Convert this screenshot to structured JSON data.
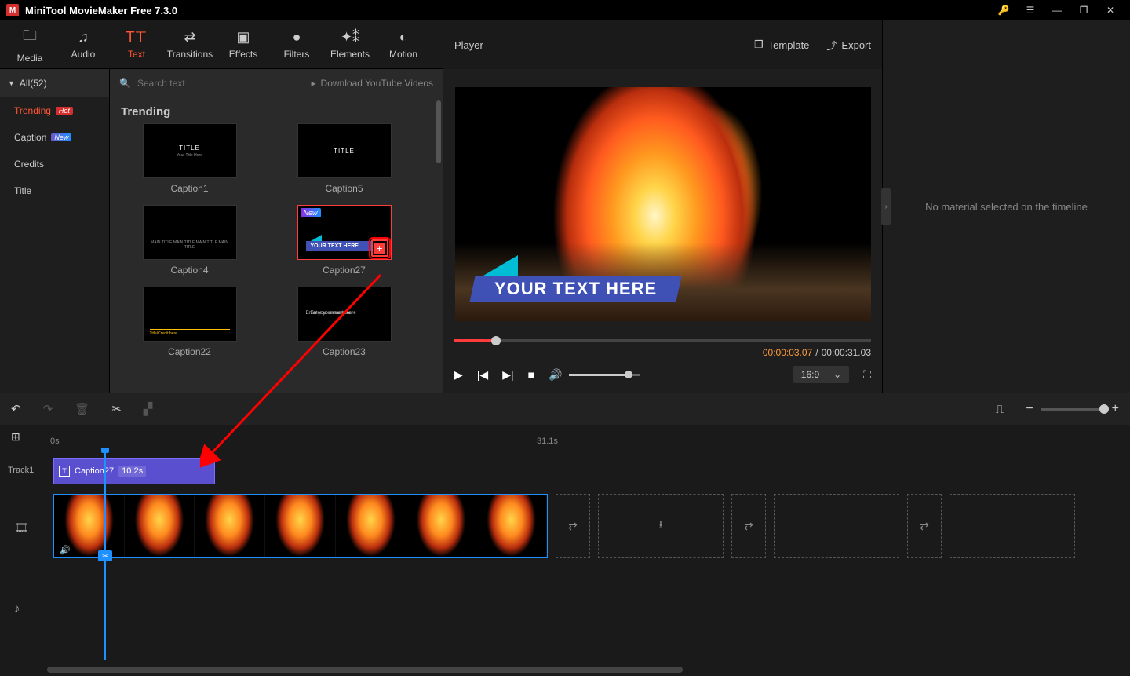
{
  "app": {
    "title": "MiniTool MovieMaker Free 7.3.0"
  },
  "toolbar": {
    "media": "Media",
    "audio": "Audio",
    "text": "Text",
    "transitions": "Transitions",
    "effects": "Effects",
    "filters": "Filters",
    "elements": "Elements",
    "motion": "Motion"
  },
  "categories": {
    "all": "All(52)",
    "items": [
      {
        "label": "Trending",
        "badge": "Hot",
        "active": true
      },
      {
        "label": "Caption",
        "badge": "New"
      },
      {
        "label": "Credits"
      },
      {
        "label": "Title"
      }
    ]
  },
  "search": {
    "placeholder": "Search text"
  },
  "download_yt": "Download YouTube Videos",
  "section": {
    "title": "Trending"
  },
  "thumbs": {
    "cap1_pv_title": "TITLE",
    "cap1_pv_sub": "Your Title Here",
    "cap5_pv": "TITLE",
    "cap4_pv": "MAIN TITLE MAIN TITLE MAIN TITLE MAIN TITLE",
    "cap27_pv": "YOUR TEXT HERE",
    "cap22_pv": "Title/Credit here",
    "cap23_pv": "Enter your name here",
    "l": [
      {
        "label": "Caption1"
      },
      {
        "label": "Caption5"
      },
      {
        "label": "Caption4"
      },
      {
        "label": "Caption27",
        "selected": true,
        "new": true,
        "add": true
      },
      {
        "label": "Caption22"
      },
      {
        "label": "Caption23"
      }
    ]
  },
  "player": {
    "title": "Player",
    "template": "Template",
    "export": "Export",
    "overlay_text": "YOUR TEXT HERE",
    "time_current": "00:00:03.07",
    "time_sep": "/",
    "time_total": "00:00:31.03",
    "ratio": "16:9"
  },
  "inspector": {
    "empty": "No material selected on the timeline"
  },
  "timeline": {
    "ruler_start": "0s",
    "ruler_mid": "31.1s",
    "track1_label": "Track1",
    "clip_name": "Caption27",
    "clip_duration": "10.2s"
  }
}
